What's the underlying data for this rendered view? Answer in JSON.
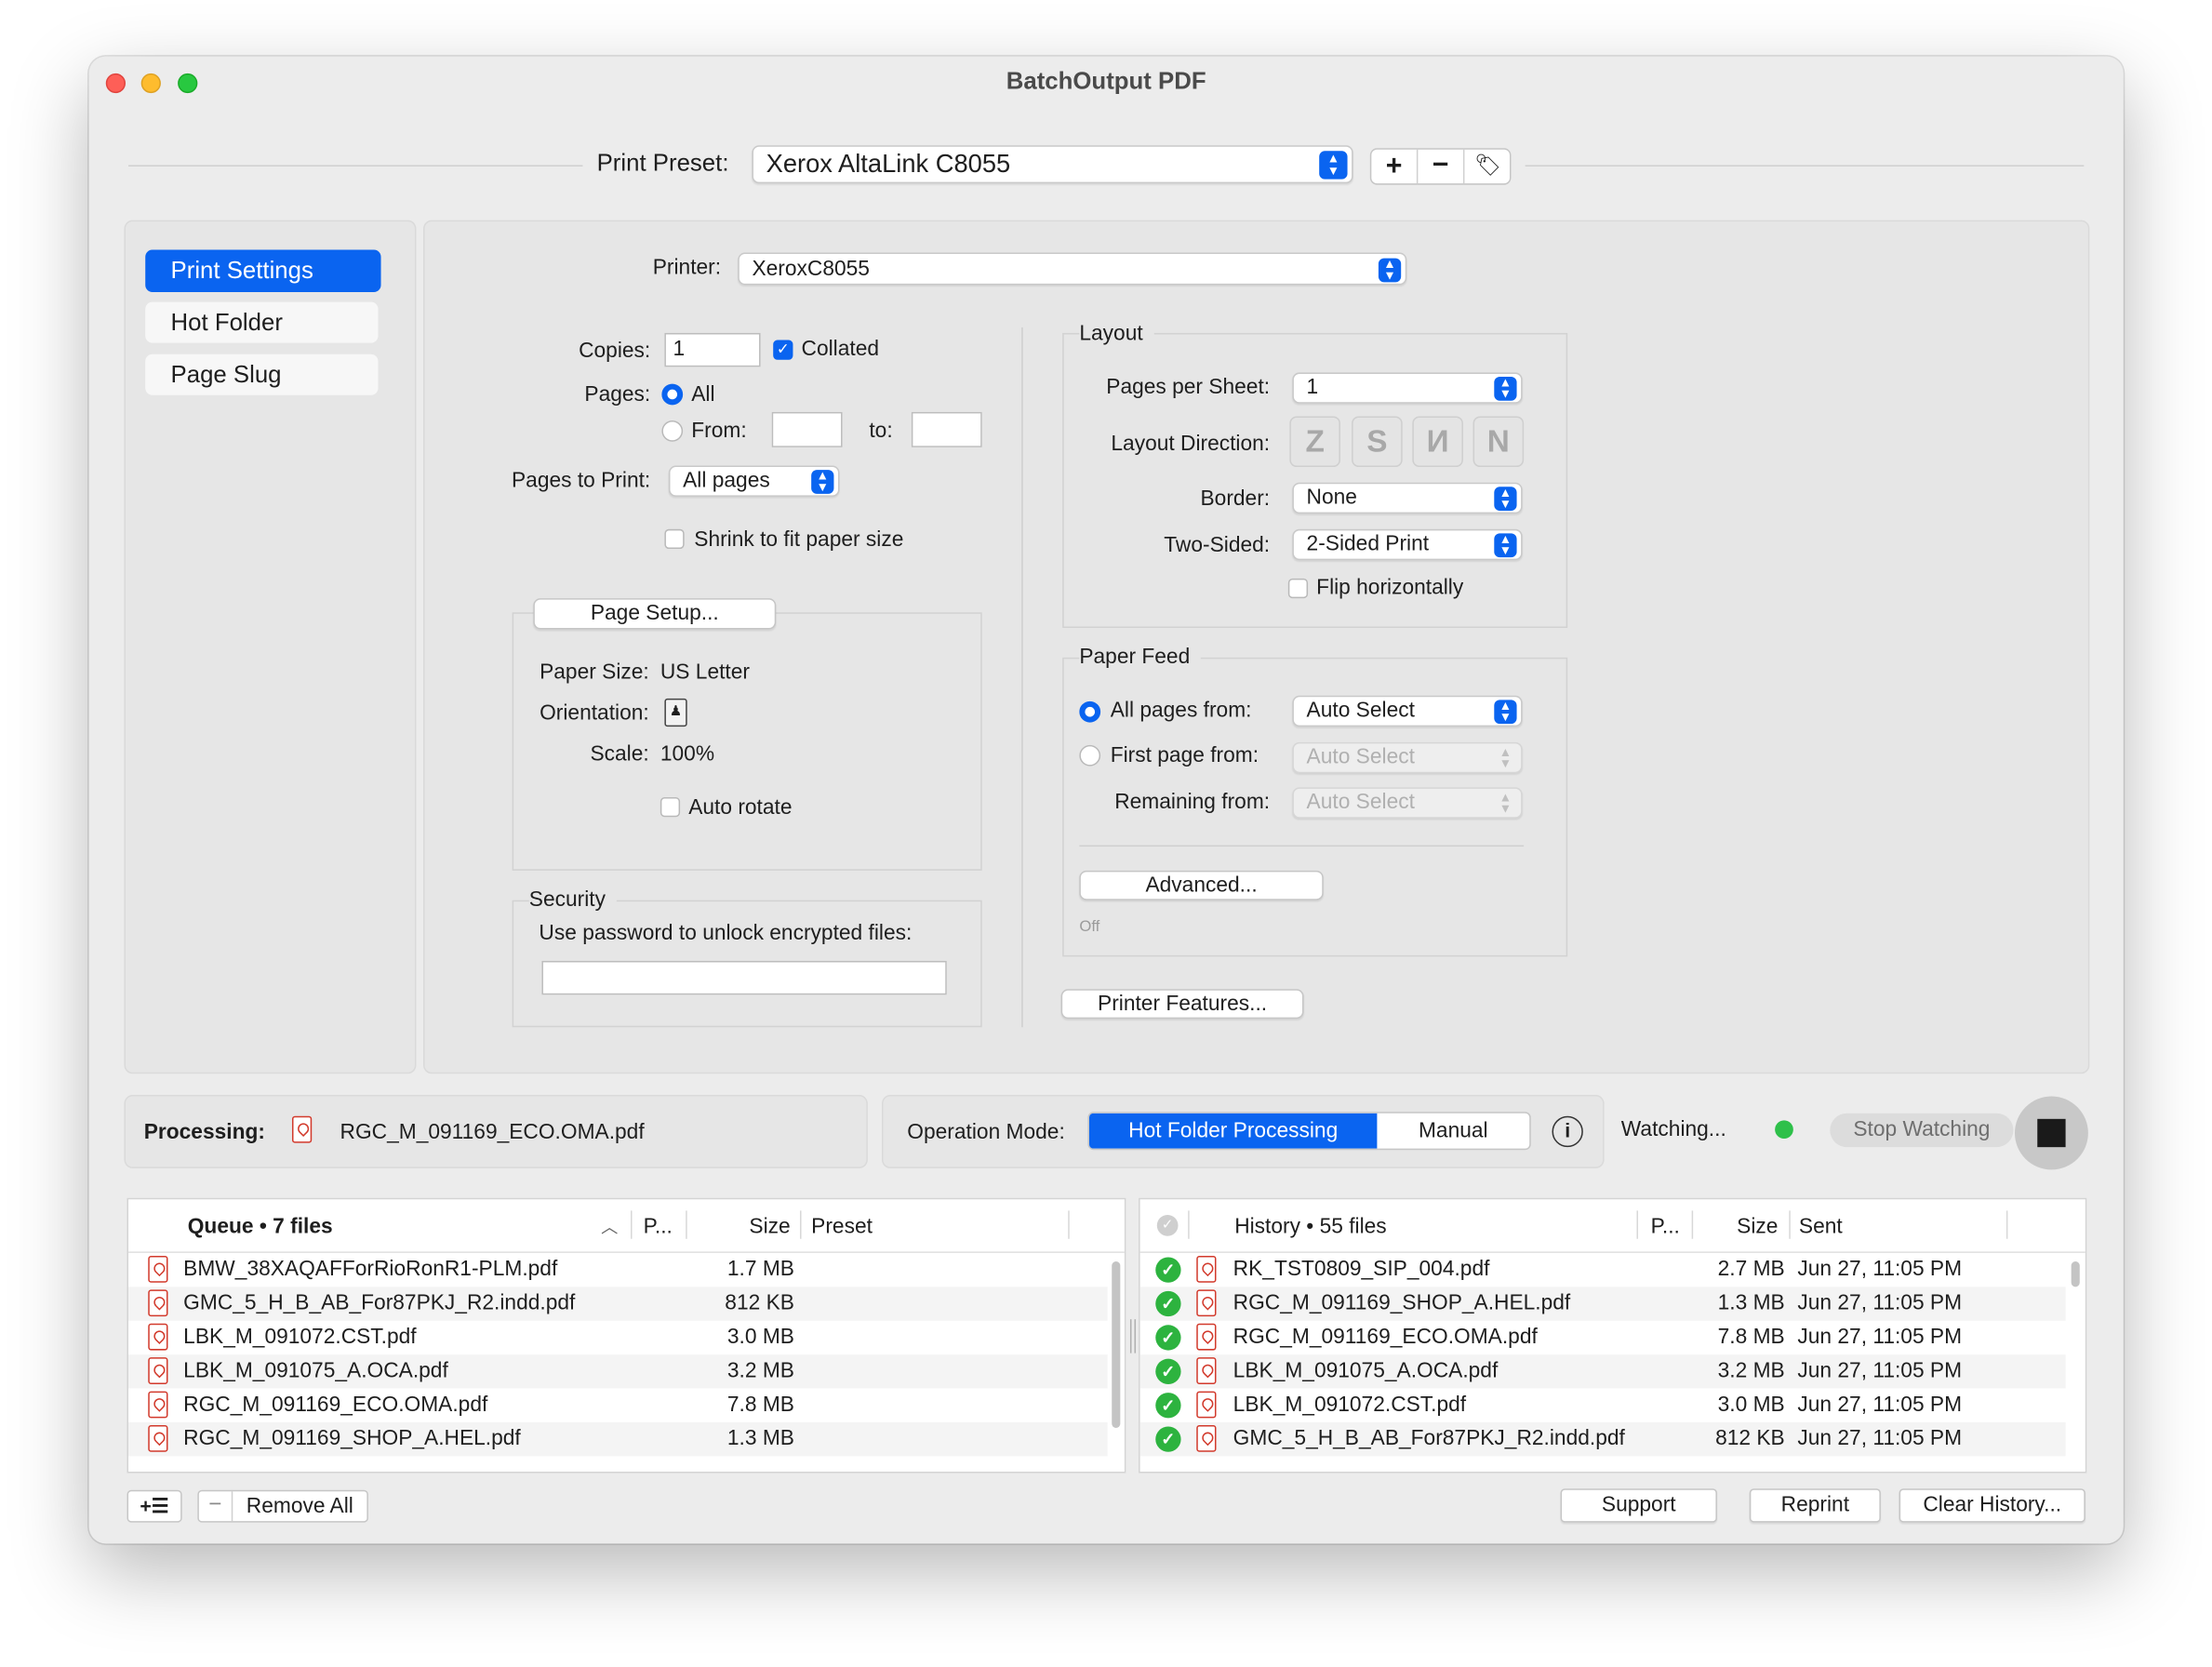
{
  "window": {
    "title": "BatchOutput PDF"
  },
  "preset": {
    "label": "Print Preset:",
    "value": "Xerox AltaLink C8055"
  },
  "sidebar": {
    "items": [
      {
        "label": "Print Settings",
        "selected": true
      },
      {
        "label": "Hot Folder",
        "selected": false
      },
      {
        "label": "Page Slug",
        "selected": false
      }
    ]
  },
  "settings": {
    "printer_label": "Printer:",
    "printer_value": "XeroxC8055",
    "copies_label": "Copies:",
    "copies_value": "1",
    "collated_label": "Collated",
    "pages_label": "Pages:",
    "all_label": "All",
    "from_label": "From:",
    "to_label": "to:",
    "pages_to_print_label": "Pages to Print:",
    "pages_to_print_value": "All pages",
    "shrink_label": "Shrink to fit paper size",
    "page_setup_button": "Page Setup...",
    "paper_size_label": "Paper Size:",
    "paper_size_value": "US Letter",
    "orientation_label": "Orientation:",
    "scale_label": "Scale:",
    "scale_value": "100%",
    "auto_rotate_label": "Auto rotate",
    "security_title": "Security",
    "security_text": "Use password to unlock encrypted files:"
  },
  "layout": {
    "title": "Layout",
    "pages_per_sheet_label": "Pages per Sheet:",
    "pages_per_sheet_value": "1",
    "direction_label": "Layout Direction:",
    "border_label": "Border:",
    "border_value": "None",
    "two_sided_label": "Two-Sided:",
    "two_sided_value": "2-Sided Print",
    "flip_label": "Flip horizontally"
  },
  "paper_feed": {
    "title": "Paper Feed",
    "all_pages_label": "All pages from:",
    "all_pages_value": "Auto Select",
    "first_page_label": "First page from:",
    "first_page_value": "Auto Select",
    "remaining_label": "Remaining from:",
    "remaining_value": "Auto Select",
    "advanced_button": "Advanced...",
    "advanced_status": "Off",
    "printer_features_button": "Printer Features..."
  },
  "status": {
    "processing_label": "Processing:",
    "processing_file": "RGC_M_091169_ECO.OMA.pdf",
    "mode_label": "Operation Mode:",
    "mode_hot": "Hot Folder Processing",
    "mode_manual": "Manual",
    "watching_label": "Watching...",
    "stop_button": "Stop Watching",
    "watch_color": "#2ec04a",
    "accent_color": "#0a64f0"
  },
  "queue": {
    "title": "Queue • 7 files",
    "col_p": "P...",
    "col_size": "Size",
    "col_preset": "Preset",
    "rows": [
      {
        "name": "BMW_38XAQAFForRioRonR1-PLM.pdf",
        "size": "1.7 MB",
        "preset": ""
      },
      {
        "name": "GMC_5_H_B_AB_For87PKJ_R2.indd.pdf",
        "size": "812 KB",
        "preset": ""
      },
      {
        "name": "LBK_M_091072.CST.pdf",
        "size": "3.0 MB",
        "preset": ""
      },
      {
        "name": "LBK_M_091075_A.OCA.pdf",
        "size": "3.2 MB",
        "preset": ""
      },
      {
        "name": "RGC_M_091169_ECO.OMA.pdf",
        "size": "7.8 MB",
        "preset": ""
      },
      {
        "name": "RGC_M_091169_SHOP_A.HEL.pdf",
        "size": "1.3 MB",
        "preset": ""
      }
    ]
  },
  "history": {
    "title": "History • 55 files",
    "col_p": "P...",
    "col_size": "Size",
    "col_sent": "Sent",
    "rows": [
      {
        "name": "RK_TST0809_SIP_004.pdf",
        "size": "2.7 MB",
        "sent": "Jun 27, 11:05 PM"
      },
      {
        "name": "RGC_M_091169_SHOP_A.HEL.pdf",
        "size": "1.3 MB",
        "sent": "Jun 27, 11:05 PM"
      },
      {
        "name": "RGC_M_091169_ECO.OMA.pdf",
        "size": "7.8 MB",
        "sent": "Jun 27, 11:05 PM"
      },
      {
        "name": "LBK_M_091075_A.OCA.pdf",
        "size": "3.2 MB",
        "sent": "Jun 27, 11:05 PM"
      },
      {
        "name": "LBK_M_091072.CST.pdf",
        "size": "3.0 MB",
        "sent": "Jun 27, 11:05 PM"
      },
      {
        "name": "GMC_5_H_B_AB_For87PKJ_R2.indd.pdf",
        "size": "812 KB",
        "sent": "Jun 27, 11:05 PM"
      }
    ]
  },
  "footer": {
    "remove_all": "Remove All",
    "support": "Support",
    "reprint": "Reprint",
    "clear_history": "Clear History..."
  }
}
